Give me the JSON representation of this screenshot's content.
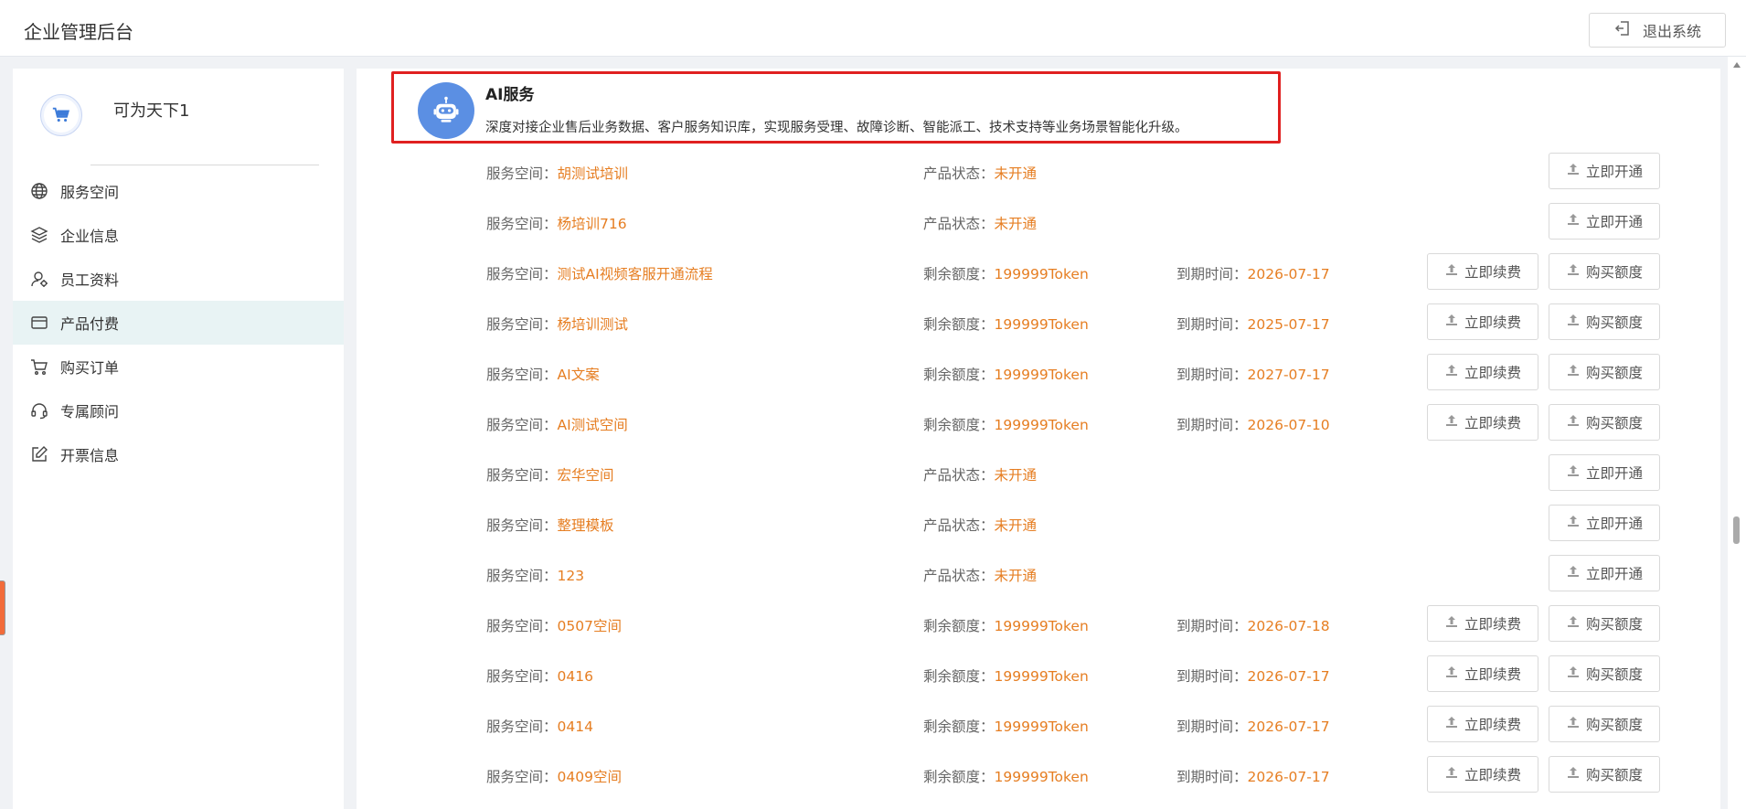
{
  "header": {
    "title": "企业管理后台",
    "logout_label": "退出系统"
  },
  "sidebar": {
    "company_name": "可为天下1",
    "items": [
      {
        "label": "服务空间",
        "icon": "globe-icon"
      },
      {
        "label": "企业信息",
        "icon": "layers-icon"
      },
      {
        "label": "员工资料",
        "icon": "user-icon"
      },
      {
        "label": "产品付费",
        "icon": "card-icon",
        "active": true
      },
      {
        "label": "购买订单",
        "icon": "cart-icon"
      },
      {
        "label": "专属顾问",
        "icon": "headset-icon"
      },
      {
        "label": "开票信息",
        "icon": "edit-icon"
      }
    ]
  },
  "product": {
    "title": "AI服务",
    "description": "深度对接企业售后业务数据、客户服务知识库，实现服务受理、故障诊断、智能派工、技术支持等业务场景智能化升级。"
  },
  "labels": {
    "space": "服务空间：",
    "status": "产品状态：",
    "quota": "剩余额度：",
    "expiry": "到期时间："
  },
  "buttons": {
    "open": "立即开通",
    "renew": "立即续费",
    "buy": "购买额度"
  },
  "rows": [
    {
      "space": "胡测试培训",
      "status": "未开通"
    },
    {
      "space": "杨培训716",
      "status": "未开通"
    },
    {
      "space": "测试AI视频客服开通流程",
      "quota": "199999Token",
      "expiry": "2026-07-17"
    },
    {
      "space": "杨培训测试",
      "quota": "199999Token",
      "expiry": "2025-07-17"
    },
    {
      "space": "AI文案",
      "quota": "199999Token",
      "expiry": "2027-07-17"
    },
    {
      "space": "AI测试空间",
      "quota": "199999Token",
      "expiry": "2026-07-10"
    },
    {
      "space": "宏华空间",
      "status": "未开通"
    },
    {
      "space": "整理模板",
      "status": "未开通"
    },
    {
      "space": "123",
      "status": "未开通"
    },
    {
      "space": "0507空间",
      "quota": "199999Token",
      "expiry": "2026-07-18"
    },
    {
      "space": "0416",
      "quota": "199999Token",
      "expiry": "2026-07-17"
    },
    {
      "space": "0414",
      "quota": "199999Token",
      "expiry": "2026-07-17"
    },
    {
      "space": "0409空间",
      "quota": "199999Token",
      "expiry": "2026-07-17"
    }
  ]
}
